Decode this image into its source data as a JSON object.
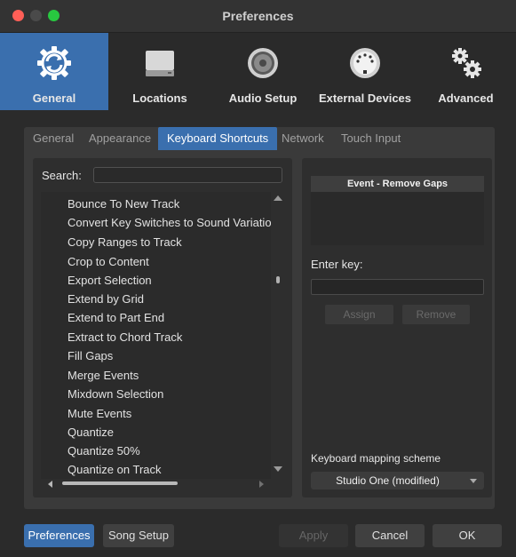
{
  "window": {
    "title": "Preferences"
  },
  "toolbar": {
    "items": [
      {
        "label": "General",
        "icon": "gear-circle-icon",
        "active": true
      },
      {
        "label": "Locations",
        "icon": "hard-drive-icon",
        "active": false
      },
      {
        "label": "Audio Setup",
        "icon": "speaker-icon",
        "active": false
      },
      {
        "label": "External Devices",
        "icon": "midi-connector-icon",
        "active": false
      },
      {
        "label": "Advanced",
        "icon": "gears-icon",
        "active": false
      }
    ]
  },
  "tabs": [
    {
      "label": "General",
      "active": false
    },
    {
      "label": "Appearance",
      "active": false
    },
    {
      "label": "Keyboard Shortcuts",
      "active": true
    },
    {
      "label": "Network",
      "active": false
    },
    {
      "label": "Touch Input",
      "active": false
    }
  ],
  "search": {
    "label": "Search:",
    "value": ""
  },
  "commands": [
    "Bounce To New Track",
    "Convert Key Switches to Sound Variations",
    "Copy Ranges to Track",
    "Crop to Content",
    "Export Selection",
    "Extend by Grid",
    "Extend to Part End",
    "Extract to Chord Track",
    "Fill Gaps",
    "Merge Events",
    "Mixdown Selection",
    "Mute Events",
    "Quantize",
    "Quantize 50%",
    "Quantize on Track"
  ],
  "event_panel": {
    "header": "Event - Remove Gaps",
    "enter_key_label": "Enter key:",
    "enter_key_value": "",
    "assign_label": "Assign",
    "remove_label": "Remove",
    "scheme_label": "Keyboard mapping scheme",
    "scheme_value": "Studio One (modified)"
  },
  "bottom": {
    "preferences": "Preferences",
    "song_setup": "Song Setup",
    "apply": "Apply",
    "cancel": "Cancel",
    "ok": "OK"
  },
  "colors": {
    "accent": "#3a6fae",
    "background": "#2b2b2b",
    "panel": "#3a3a3a"
  }
}
